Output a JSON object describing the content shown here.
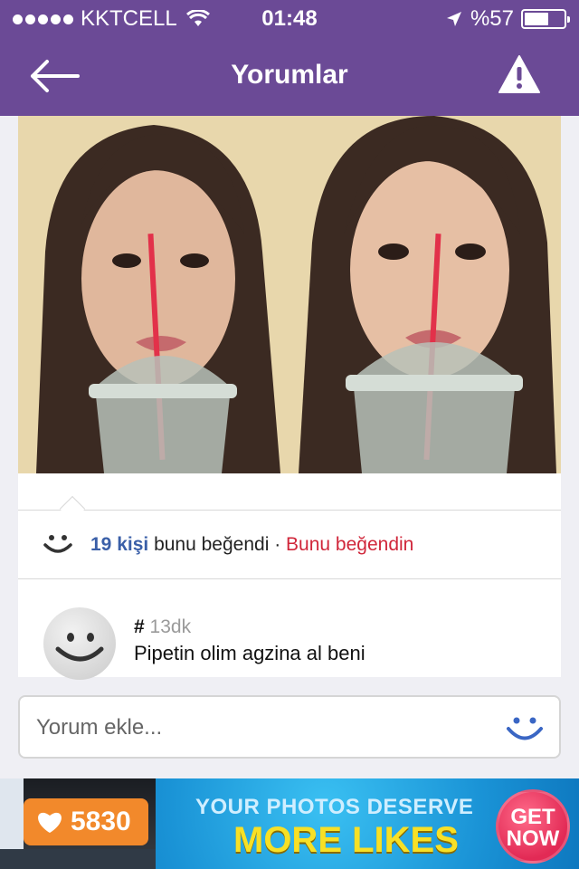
{
  "status_bar": {
    "carrier": "KKTCELL",
    "time": "01:48",
    "battery": "%57",
    "battery_level": 0.57
  },
  "nav": {
    "title": "Yorumlar"
  },
  "likes": {
    "count_label": "19 kişi",
    "text": "bunu beğendi",
    "separator": " · ",
    "liked_label": "Bunu beğendin"
  },
  "comment": {
    "hash": "#",
    "time": "13dk",
    "body": "Pipetin olim agzina al beni"
  },
  "input": {
    "placeholder": "Yorum ekle..."
  },
  "ad": {
    "likes_count": "5830",
    "line1": "YOUR PHOTOS DESERVE",
    "line2": "MORE LIKES",
    "cta": "GET NOW"
  },
  "colors": {
    "header": "#6b4a96",
    "link": "#3a5fa8",
    "liked": "#d0263a"
  }
}
